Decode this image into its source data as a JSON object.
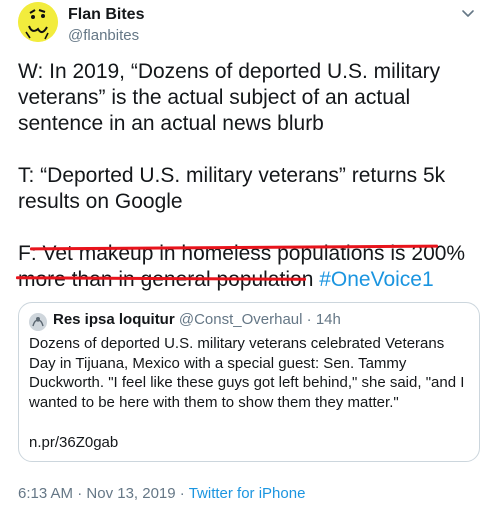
{
  "author": {
    "name": "Flan Bites",
    "handle": "@flanbites"
  },
  "tweet": {
    "line_w": "W: In 2019, “Dozens of deported U.S. military veterans” is the actual subject of an actual sentence in an actual news blurb",
    "line_t": "T: “Deported U.S. military veterans” returns 5k results on Google",
    "line_f_prefix": "F: ",
    "line_f_text": "Vet makeup in homeless populations is 200% more than in general population",
    "hashtag": "#OneVoice1"
  },
  "quote": {
    "name": "Res ipsa loquitur",
    "handle": "@Const_Overhaul",
    "separator": "·",
    "age": "14h",
    "text": "Dozens of deported U.S. military veterans celebrated Veterans Day in Tijuana, Mexico with a special guest: Sen. Tammy Duckworth. \"I feel like these guys got left behind,\" she said, \"and I wanted to be here with them to show them they matter.\"",
    "link": "n.pr/36Z0gab"
  },
  "footer": {
    "time": "6:13 AM",
    "separator1": "·",
    "date": "Nov 13, 2019",
    "separator2": "·",
    "source": "Twitter for iPhone"
  },
  "colors": {
    "link_blue": "#1b95e0",
    "underline_red": "#e8141c",
    "avatar_yellow": "#f2ec3d",
    "muted_gray": "#657786"
  },
  "icons": {
    "avatar": "yellow-cartoon-face-avatar",
    "more": "chevron-down-icon",
    "quote_avatar": "hands-avatar"
  }
}
